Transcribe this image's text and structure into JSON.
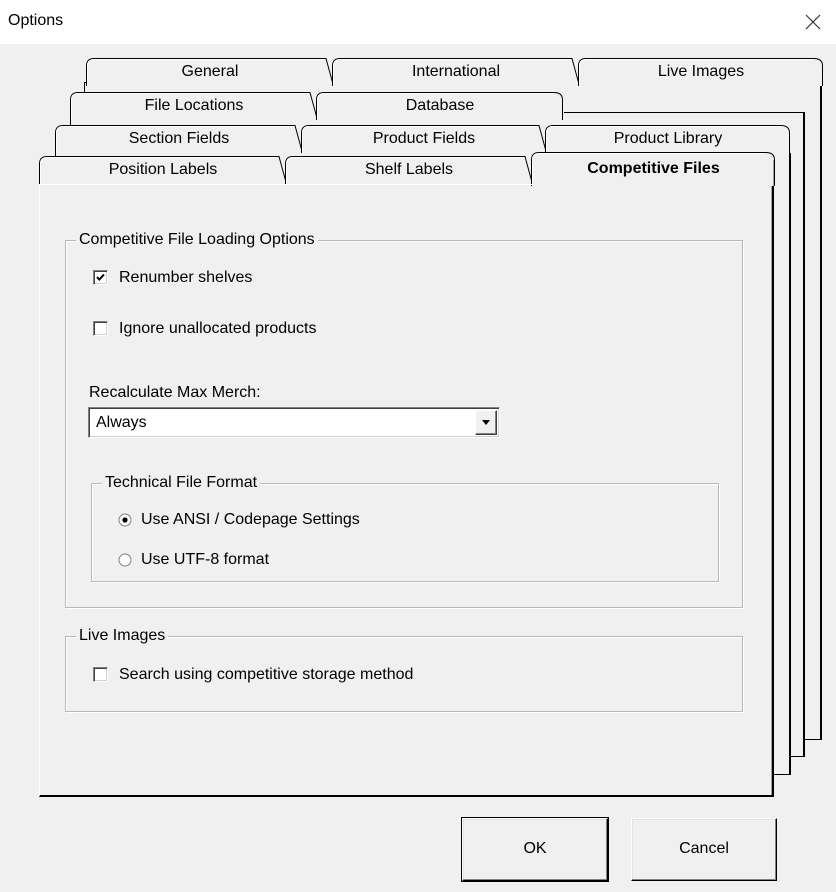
{
  "window": {
    "title": "Options",
    "close_icon": "close-icon"
  },
  "tabs": {
    "row1": [
      "General",
      "International",
      "Live Images"
    ],
    "row2": [
      "File Locations",
      "Database"
    ],
    "row3": [
      "Section Fields",
      "Product Fields",
      "Product Library"
    ],
    "row4": [
      "Position Labels",
      "Shelf Labels",
      "Competitive Files"
    ],
    "active": "Competitive Files"
  },
  "loading_group": {
    "legend": "Competitive File Loading Options",
    "renumber_shelves": {
      "label": "Renumber shelves",
      "checked": true
    },
    "ignore_unallocated": {
      "label": "Ignore unallocated products",
      "checked": false
    },
    "recalc_label": "Recalculate Max Merch:",
    "recalc_value": "Always",
    "format_group": {
      "legend": "Technical File Format",
      "options": [
        "Use ANSI / Codepage Settings",
        "Use UTF-8 format"
      ],
      "selected": "Use ANSI / Codepage Settings"
    }
  },
  "live_images_group": {
    "legend": "Live Images",
    "search_competitive": {
      "label": "Search using competitive storage method",
      "checked": false
    }
  },
  "buttons": {
    "ok": "OK",
    "cancel": "Cancel"
  }
}
